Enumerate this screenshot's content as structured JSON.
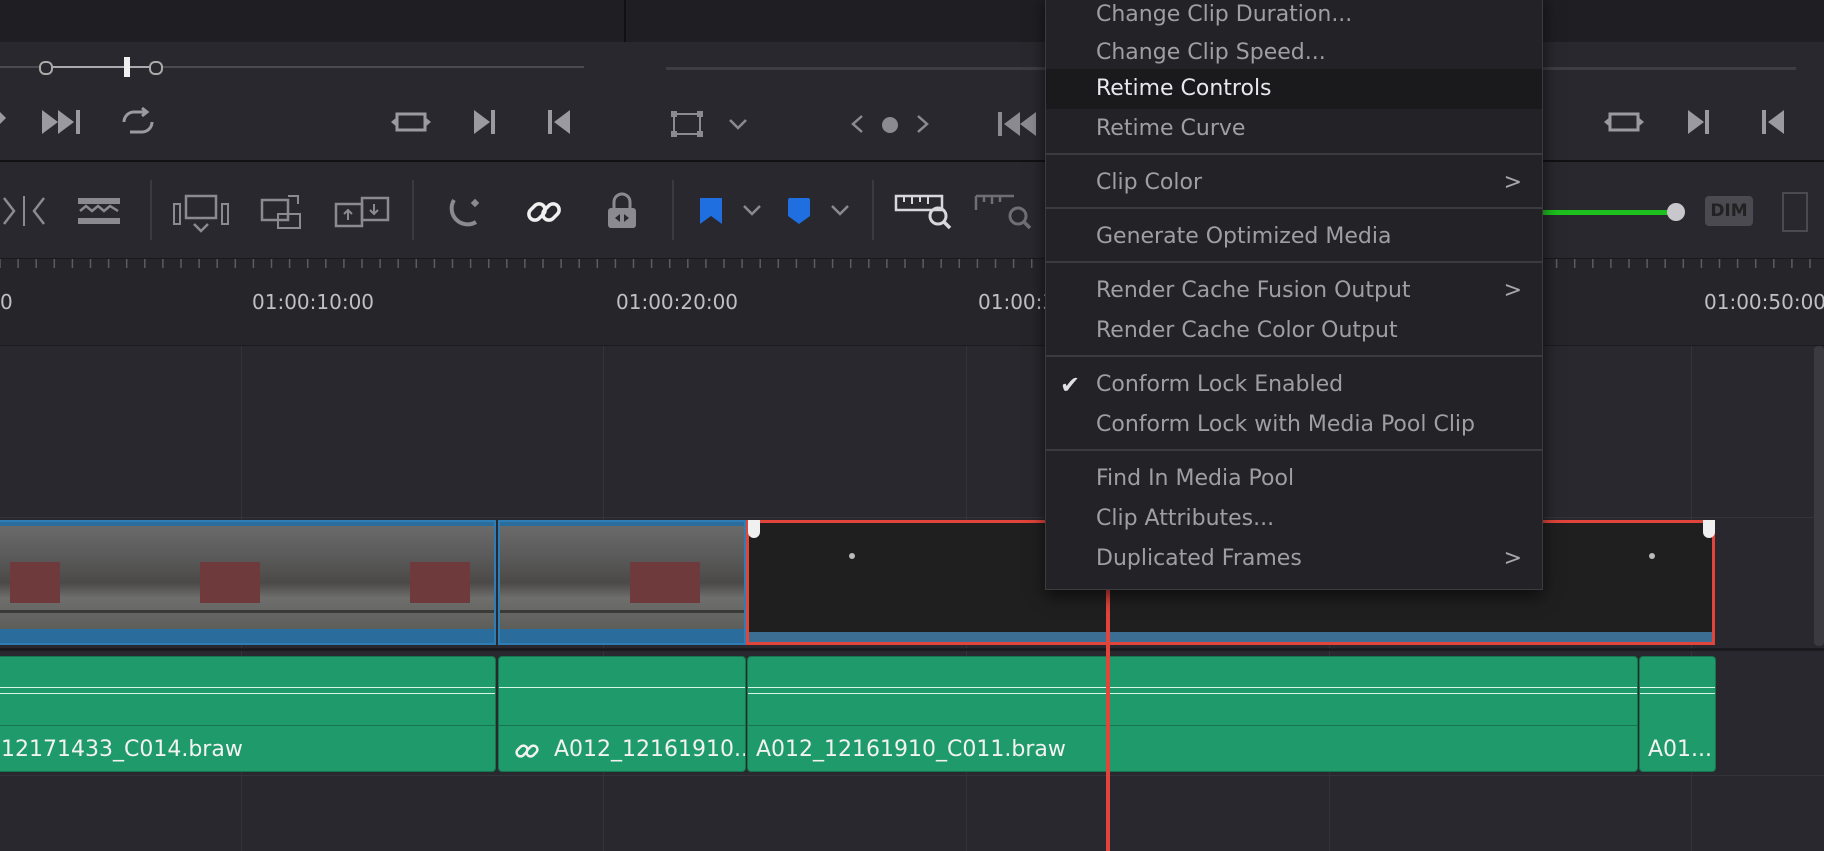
{
  "timeline": {
    "timecodes": [
      "01:00:10:00",
      "01:00:20:00",
      "01:00:3",
      "01:00:50:00"
    ],
    "left_partial_tick": "0"
  },
  "audio_clips": [
    {
      "label": "12171433_C014.braw",
      "linked": false
    },
    {
      "label": "A012_12161910...",
      "linked": true
    },
    {
      "label": "A012_12161910_C011.braw",
      "linked": false
    },
    {
      "label": "A01...",
      "linked": false
    }
  ],
  "toolbar": {
    "dim_label": "DIM",
    "flag_color": "#1f6fe0",
    "marker_color": "#1f6fe0"
  },
  "context_menu": {
    "items": [
      {
        "label": "Change Clip Duration...",
        "submenu": false,
        "checked": false,
        "active": false
      },
      {
        "label": "Change Clip Speed...",
        "submenu": false,
        "checked": false,
        "active": false
      },
      {
        "label": "Retime Controls",
        "submenu": false,
        "checked": false,
        "active": true
      },
      {
        "label": "Retime Curve",
        "submenu": false,
        "checked": false,
        "active": false
      },
      {
        "label": "Clip Color",
        "submenu": true,
        "checked": false,
        "active": false
      },
      {
        "label": "Generate Optimized Media",
        "submenu": false,
        "checked": false,
        "active": false
      },
      {
        "label": "Render Cache Fusion Output",
        "submenu": true,
        "checked": false,
        "active": false
      },
      {
        "label": "Render Cache Color Output",
        "submenu": false,
        "checked": false,
        "active": false
      },
      {
        "label": "Conform Lock Enabled",
        "submenu": false,
        "checked": true,
        "active": false
      },
      {
        "label": "Conform Lock with Media Pool Clip",
        "submenu": false,
        "checked": false,
        "active": false
      },
      {
        "label": "Find In Media Pool",
        "submenu": false,
        "checked": false,
        "active": false
      },
      {
        "label": "Clip Attributes...",
        "submenu": false,
        "checked": false,
        "active": false
      },
      {
        "label": "Duplicated Frames",
        "submenu": true,
        "checked": false,
        "active": false
      }
    ],
    "arrow_glyph": ">",
    "check_glyph": "✔"
  },
  "colors": {
    "video_clip": "#2a6c9b",
    "audio_clip": "#1f9a6a",
    "selection": "#e0443a",
    "playhead": "#e0443a",
    "audio_meter": "#1ec01e"
  }
}
